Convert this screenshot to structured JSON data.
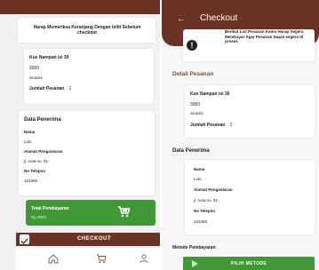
{
  "left": {
    "notice": "Harap Memeriksa Keranjang Dengan teliti Sebelum checkout",
    "item": {
      "name": "Kue Nampan isi 30",
      "price": "3000",
      "category": "Snacks",
      "qty_label": "Jumlah Pesanan",
      "qty": "1"
    },
    "recipient": {
      "title": "Data Penerima",
      "name_label": "Nama",
      "name": "Lulu",
      "address_label": "Alamat Pengantaran",
      "address": "jl. rusa no. 91",
      "phone_label": "No Telepon",
      "phone": "123456"
    },
    "total": {
      "label": "Total Pembayaran",
      "amount": "Rp 3000"
    },
    "checkout_label": "CHECKOUT",
    "nav": [
      {
        "label": "Beranda",
        "icon": "home-icon"
      },
      {
        "label": "Keranjang",
        "icon": "cart-icon"
      },
      {
        "label": "Akun",
        "icon": "account-icon"
      }
    ]
  },
  "right": {
    "title": "Checkout",
    "alert": "Berikut List Pesanan Kamu Harap Segera Membayar Agar Pesanan Dapat segera di proses",
    "detail_title": "Detail Pesanan",
    "item": {
      "name": "Kue Nampan isi 30",
      "price": "3000",
      "category": "Snacks",
      "qty_label": "Jumlah Pesanan",
      "qty": "1"
    },
    "recipient": {
      "title": "Data Penerima",
      "name_label": "Nama",
      "name": "Lulu",
      "address_label": "Alamat Pengantaran",
      "address": "jl. rusa no. 91",
      "phone_label": "No Telepon",
      "phone": "123456"
    },
    "payment_title": "Metode Pembayaran",
    "pay_button": "PILIH METODE"
  },
  "colors": {
    "brown": "#6b3323",
    "green": "#3f9a35",
    "accent_text": "#8a4a2a"
  }
}
